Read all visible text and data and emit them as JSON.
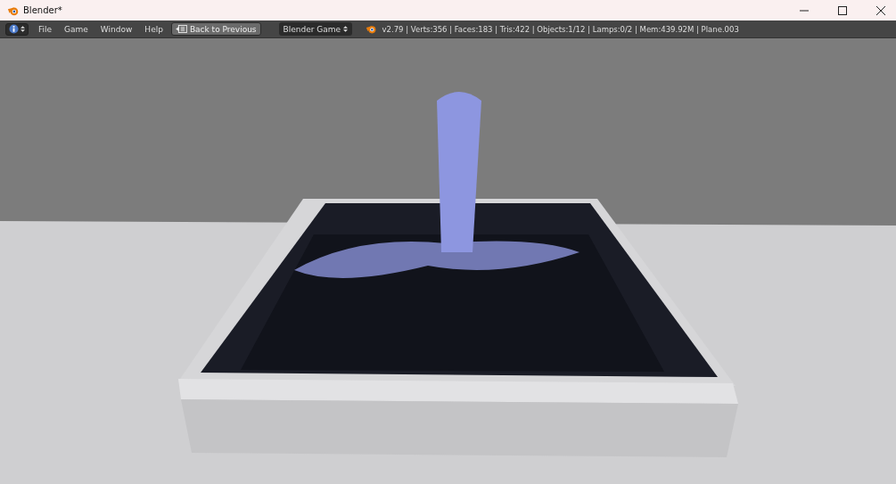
{
  "window": {
    "title": "Blender*"
  },
  "menu": [
    "File",
    "Game",
    "Window",
    "Help"
  ],
  "back_button": {
    "label": "Back to Previous"
  },
  "engine": {
    "value": "Blender Game"
  },
  "stats": "v2.79 | Verts:356 | Faces:183 | Tris:422 | Objects:1/12 | Lamps:0/2 | Mem:439.92M | Plane.003"
}
